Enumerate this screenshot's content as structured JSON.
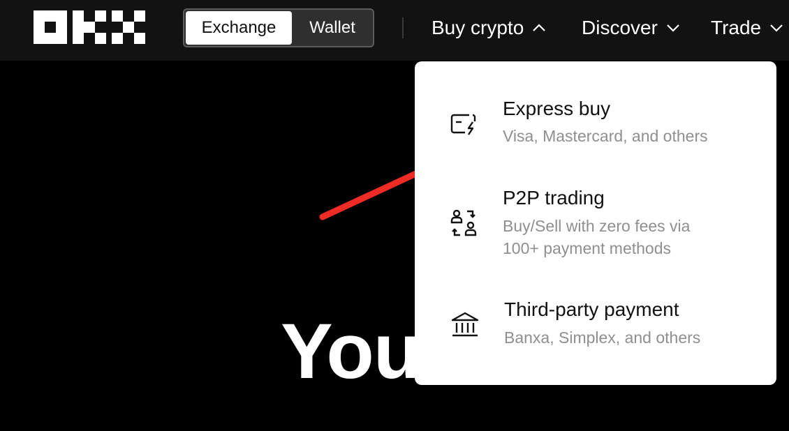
{
  "header": {
    "toggle": {
      "exchange_label": "Exchange",
      "wallet_label": "Wallet"
    },
    "nav": {
      "buy_crypto": "Buy crypto",
      "discover": "Discover",
      "trade": "Trade"
    }
  },
  "hero": {
    "title": "You"
  },
  "buy_crypto_menu": {
    "items": [
      {
        "title": "Express buy",
        "description": "Visa, Mastercard, and others",
        "icon": "card-bolt-icon"
      },
      {
        "title": "P2P trading",
        "description_line1": "Buy/Sell with zero fees via",
        "description_line2": "100+ payment methods",
        "icon": "p2p-exchange-icon"
      },
      {
        "title": "Third-party payment",
        "description": "Banxa, Simplex, and others",
        "icon": "bank-icon"
      }
    ]
  },
  "colors": {
    "background": "#000000",
    "topbar": "#121212",
    "annotation_arrow": "#ee2b24",
    "dropdown_bg": "#ffffff",
    "muted_text": "#8f8f8f"
  }
}
